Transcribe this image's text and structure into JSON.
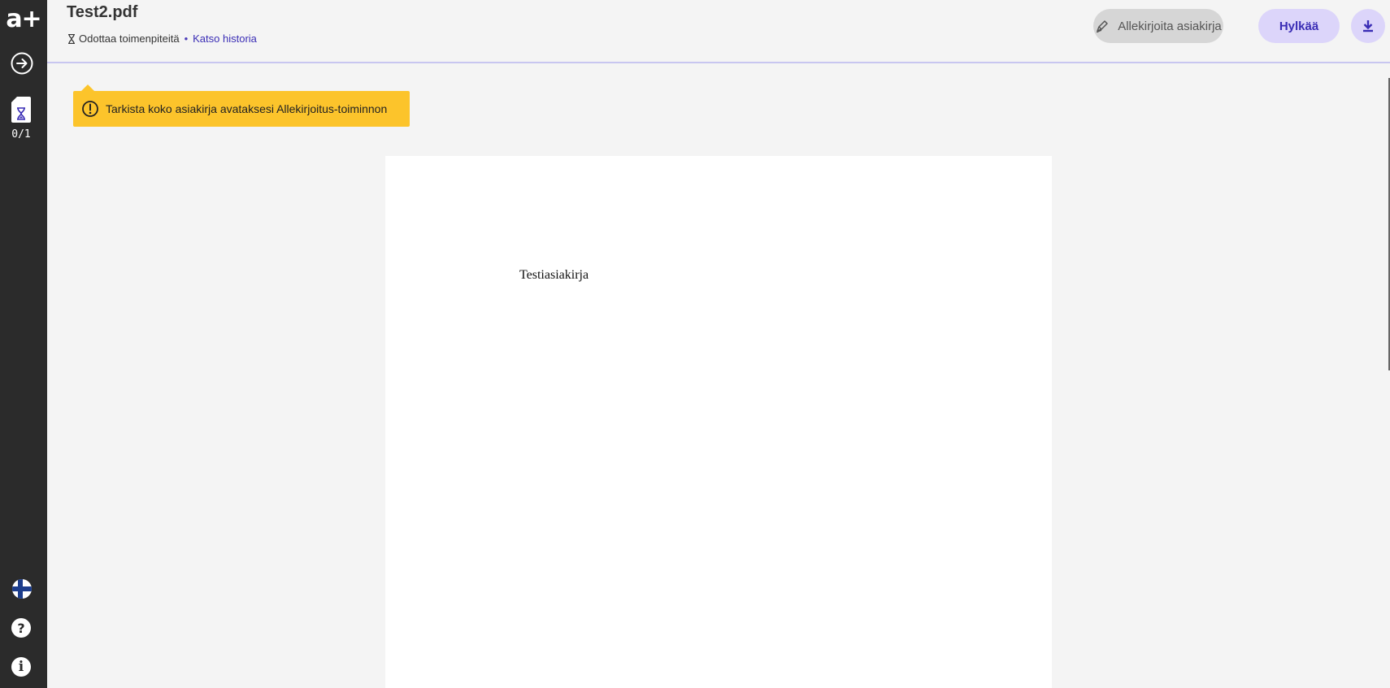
{
  "sidebar": {
    "logo": "a+",
    "doc_counter": "0/1"
  },
  "header": {
    "title": "Test2.pdf",
    "status": "Odottaa toimenpiteitä",
    "separator": "•",
    "history_link": "Katso historia",
    "sign_button": "Allekirjoita asiakirja",
    "reject_button": "Hylkää"
  },
  "notice": {
    "text": "Tarkista koko asiakirja avataksesi Allekirjoitus-toiminnon"
  },
  "document": {
    "text": "Testiasiakirja"
  },
  "colors": {
    "sidebar": "#2b2b2b",
    "accent": "#3a2db5",
    "accent_light": "#dcd5fa",
    "warning": "#fcc42b"
  }
}
